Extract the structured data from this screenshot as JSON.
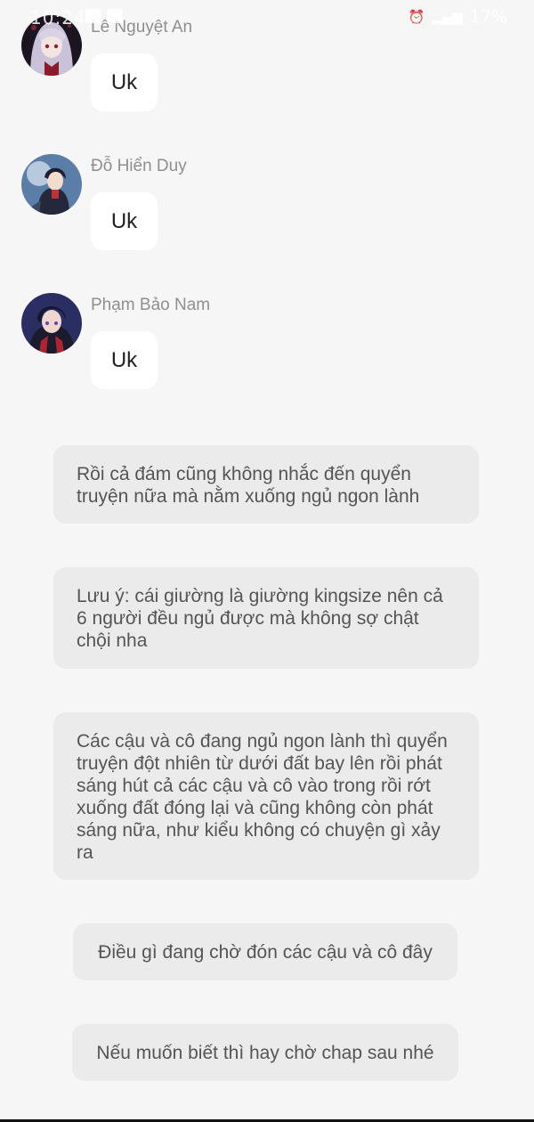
{
  "status_bar": {
    "time": "10:24",
    "battery": "17%"
  },
  "messages": [
    {
      "sender": "Lê Nguyệt An",
      "text": "Uk"
    },
    {
      "sender": "Đỗ Hiển Duy",
      "text": "Uk"
    },
    {
      "sender": "Phạm Bảo Nam",
      "text": "Uk"
    }
  ],
  "narrations": [
    "Rồi cả đám cũng không nhắc đến quyển truyện nữa mà nằm xuống ngủ ngon lành",
    "Lưu ý: cái giường là giường kingsize nên cả 6 người đều ngủ được mà không sợ chật chội nha",
    "Các cậu và cô đang ngủ ngon lành thì quyển truyện đột nhiên từ dưới đất bay lên rồi phát sáng hút cả các cậu và cô vào trong rồi rớt xuống đất đóng lại và cũng không còn phát sáng nữa, như kiểu không có chuyện gì xảy ra",
    "Điều gì đang chờ đón các cậu và cô đây",
    "Nếu muốn biết thì hay chờ chap sau nhé"
  ],
  "icons": {
    "avatar_1": "anime-girl-avatar-icon",
    "avatar_2": "anime-boy-avatar-icon",
    "avatar_3": "anime-boy-avatar-icon"
  },
  "colors": {
    "background": "#f6f6f6",
    "bubble": "#ffffff",
    "narration_bubble": "#ebebeb",
    "sender_name": "#8f8f8f"
  }
}
